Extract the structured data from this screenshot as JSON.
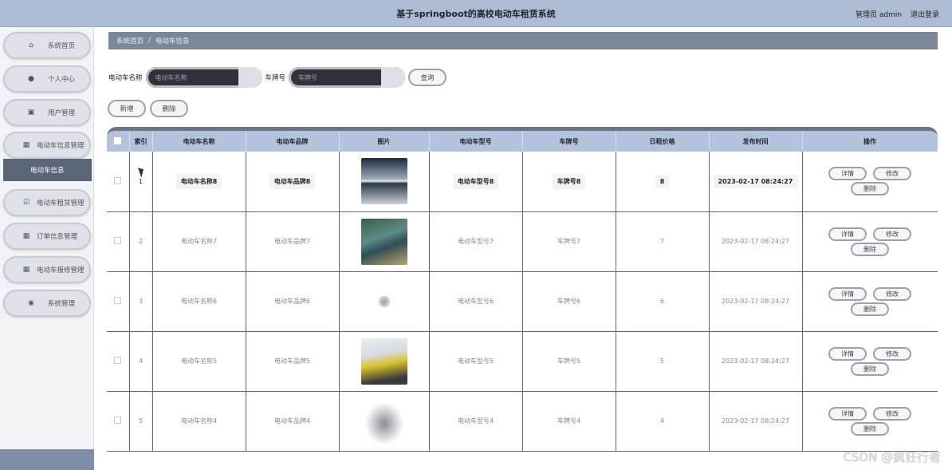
{
  "header": {
    "title": "基于springboot的高校电动车租赁系统",
    "user": "管理员 admin",
    "logout": "退出登录"
  },
  "sidebar": {
    "items": [
      {
        "label": "系统首页",
        "icon": "home-icon"
      },
      {
        "label": "个人中心",
        "icon": "user-icon"
      },
      {
        "label": "用户管理",
        "icon": "users-icon"
      },
      {
        "label": "电动车信息管理",
        "icon": "grid-icon"
      },
      {
        "label": "电动车租赁管理",
        "icon": "check-icon"
      },
      {
        "label": "订单信息管理",
        "icon": "grid-icon"
      },
      {
        "label": "电动车报修管理",
        "icon": "grid-icon"
      },
      {
        "label": "系统管理",
        "icon": "location-icon"
      }
    ],
    "active_sub": "电动车信息"
  },
  "breadcrumb": {
    "home": "系统首页",
    "sep": "/",
    "current": "电动车信息"
  },
  "search": {
    "name_label": "电动车名称",
    "name_placeholder": "电动车名称",
    "plate_label": "车牌号",
    "plate_placeholder": "车牌号",
    "query_button": "查询"
  },
  "actions": {
    "add": "新增",
    "delete": "删除"
  },
  "table": {
    "headers": [
      "索引",
      "电动车名称",
      "电动车品牌",
      "图片",
      "电动车型号",
      "车牌号",
      "日租价格",
      "发布时间",
      "操作"
    ],
    "ops": {
      "detail": "详情",
      "edit": "修改",
      "delete": "删除"
    },
    "rows": [
      {
        "index": "1",
        "name": "电动车名称8",
        "brand": "电动车品牌8",
        "image": "silver-car-image",
        "model": "电动车型号8",
        "plate": "车牌号8",
        "price": "8",
        "time": "2023-02-17 08:24:27"
      },
      {
        "index": "2",
        "name": "电动车名称7",
        "brand": "电动车品牌7",
        "image": "green-car-image",
        "model": "电动车型号7",
        "plate": "车牌号7",
        "price": "7",
        "time": "2023-02-17 08:24:27"
      },
      {
        "index": "3",
        "name": "电动车名称6",
        "brand": "电动车品牌6",
        "image": "logo-image",
        "model": "电动车型号6",
        "plate": "车牌号6",
        "price": "6",
        "time": "2023-02-17 08:24:27"
      },
      {
        "index": "4",
        "name": "电动车名称5",
        "brand": "电动车品牌5",
        "image": "yellow-car-charging-image",
        "model": "电动车型号5",
        "plate": "车牌号5",
        "price": "5",
        "time": "2023-02-17 08:24:27"
      },
      {
        "index": "5",
        "name": "电动车名称4",
        "brand": "电动车品牌4",
        "image": "white-car-image",
        "model": "电动车型号4",
        "plate": "车牌号4",
        "price": "4",
        "time": "2023-02-17 08:24:27"
      }
    ]
  },
  "watermark": "CSDN @疯狂行者"
}
